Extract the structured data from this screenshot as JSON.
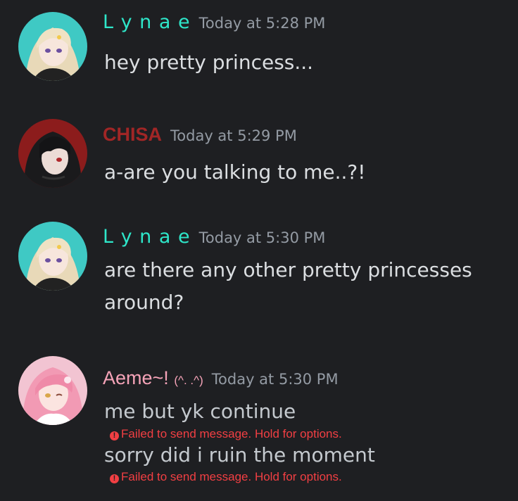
{
  "messages": [
    {
      "author": "L y n a e",
      "author_color": "#2ee6c9",
      "timestamp": "Today at 5:28 PM",
      "lines": [
        "hey pretty princess..."
      ],
      "avatar": "lynae-avatar"
    },
    {
      "author": "CHISA",
      "author_color": "#a12626",
      "timestamp": "Today at 5:29 PM",
      "lines": [
        "a-are you talking to me..?!"
      ],
      "avatar": "chisa-avatar"
    },
    {
      "author": "L y n a e",
      "author_color": "#2ee6c9",
      "timestamp": "Today at 5:30 PM",
      "lines": [
        "are there any other pretty princesses",
        "around?"
      ],
      "avatar": "lynae-avatar"
    },
    {
      "author": "Aeme~! ",
      "author_suffix": "(^. .^)",
      "author_color": "#f5a3b8",
      "timestamp": "Today at 5:30 PM",
      "lines": [
        "me but yk continue",
        "sorry did i ruin the moment"
      ],
      "failed_text": "Failed to send message. Hold for options.",
      "avatar": "aeme-avatar"
    }
  ],
  "colors": {
    "background": "#1e1f22",
    "timestamp": "#949ba4",
    "error": "#f23f43"
  }
}
